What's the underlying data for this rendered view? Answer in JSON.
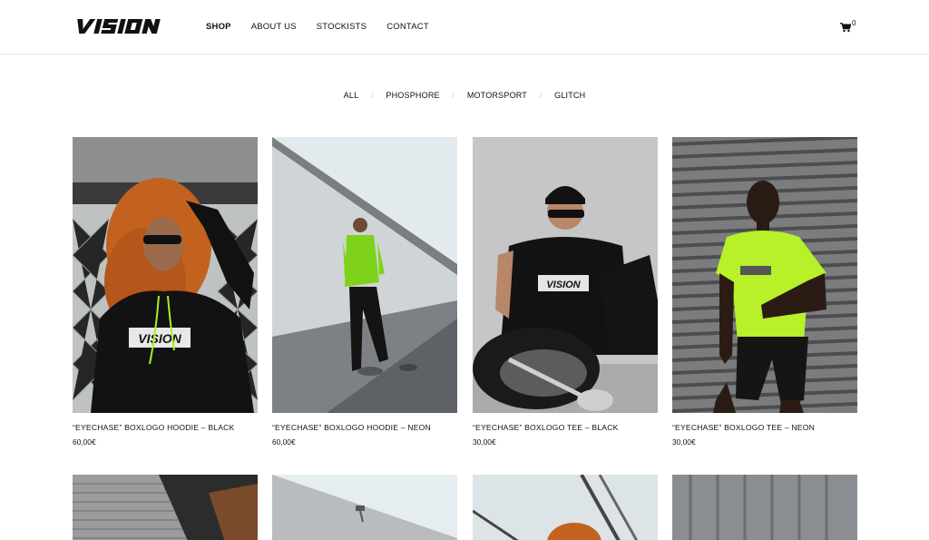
{
  "brand": {
    "logo_text": "VISION"
  },
  "nav": {
    "items": [
      {
        "label": "SHOP",
        "active": true
      },
      {
        "label": "ABOUT US",
        "active": false
      },
      {
        "label": "STOCKISTS",
        "active": false
      },
      {
        "label": "CONTACT",
        "active": false
      }
    ]
  },
  "cart": {
    "icon": "cart-icon",
    "count": "0"
  },
  "filters": {
    "items": [
      "ALL",
      "PHOSPHORE",
      "MOTORSPORT",
      "GLITCH"
    ],
    "separator": "/"
  },
  "products": [
    {
      "title": "“EYECHASE” BOXLOGO HOODIE – BLACK",
      "price": "60,00€"
    },
    {
      "title": "“EYECHASE” BOXLOGO HOODIE – NEON",
      "price": "60,00€"
    },
    {
      "title": "“EYECHASE” BOXLOGO TEE – BLACK",
      "price": "30,00€"
    },
    {
      "title": "“EYECHASE” BOXLOGO TEE – NEON",
      "price": "30,00€"
    }
  ],
  "colors": {
    "accent_neon": "#a8f21c",
    "text": "#111111",
    "divider": "#e5e5e5"
  }
}
